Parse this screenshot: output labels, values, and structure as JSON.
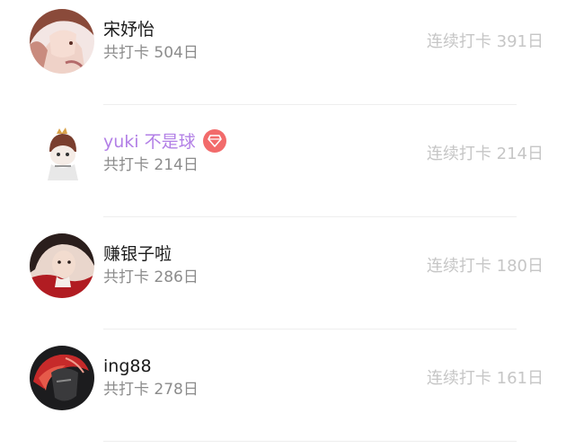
{
  "checkin_list": {
    "rows": [
      {
        "name": "宋妤怡",
        "total": "共打卡 504日",
        "streak": "连续打卡 391日",
        "vip": false,
        "avatar_icon": "anime-girl-avatar"
      },
      {
        "name": "yuki 不是球",
        "total": "共打卡 214日",
        "streak": "连续打卡 214日",
        "vip": true,
        "avatar_icon": "chibi-character-avatar"
      },
      {
        "name": "赚银子啦",
        "total": "共打卡 286日",
        "streak": "连续打卡 180日",
        "vip": false,
        "avatar_icon": "red-scarf-portrait-avatar"
      },
      {
        "name": "ing88",
        "total": "共打卡 278日",
        "streak": "连续打卡 161日",
        "vip": false,
        "avatar_icon": "dark-red-hair-avatar"
      }
    ]
  },
  "colors": {
    "vip_name": "#b27fe6",
    "vip_badge": "#f26b6b",
    "streak_text": "#c6c6c6",
    "total_text": "#8c8c8c"
  }
}
